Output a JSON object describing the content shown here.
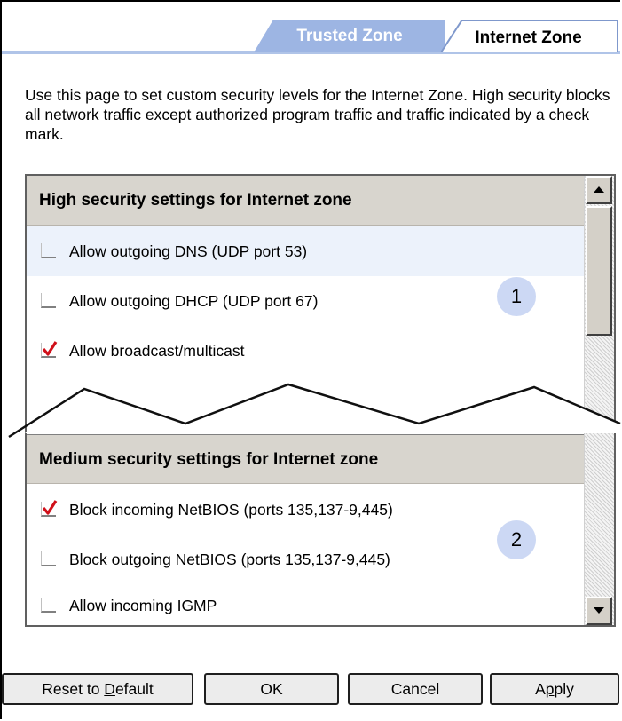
{
  "tabs": [
    {
      "label": "Trusted Zone",
      "active": false
    },
    {
      "label": "Internet Zone",
      "active": true
    }
  ],
  "description": "Use this page to set custom security levels for the Internet Zone.  High security blocks all network traffic except authorized program traffic and traffic indicated by a check mark.",
  "sections": [
    {
      "header": "High security settings for Internet zone",
      "callout": "1",
      "rows": [
        {
          "label": "Allow outgoing DNS (UDP port 53)",
          "checked": false
        },
        {
          "label": "Allow outgoing DHCP (UDP port 67)",
          "checked": false
        },
        {
          "label": "Allow broadcast/multicast",
          "checked": true
        }
      ]
    },
    {
      "header": "Medium security settings for Internet zone",
      "callout": "2",
      "rows": [
        {
          "label": "Block incoming NetBIOS (ports 135,137-9,445)",
          "checked": true
        },
        {
          "label": "Block outgoing NetBIOS (ports 135,137-9,445)",
          "checked": false
        },
        {
          "label": "Allow incoming IGMP",
          "checked": false
        }
      ]
    }
  ],
  "buttons": {
    "reset_pre": "Reset to ",
    "reset_mnemonic": "D",
    "reset_post": "efault",
    "ok": "OK",
    "cancel": "Cancel",
    "apply_pre": "A",
    "apply_mnemonic": "p",
    "apply_post": "ply"
  },
  "colors": {
    "tab_inactive": "#9db5e3",
    "check_mark": "#d0101a",
    "header_bg": "#d8d5ce",
    "callout_bg": "#ccd8f4"
  }
}
